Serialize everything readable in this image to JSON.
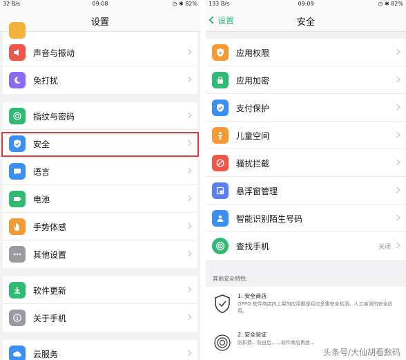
{
  "left": {
    "status": {
      "left": "32 B/s",
      "time": "09:08",
      "battery": "82%"
    },
    "title": "设置",
    "groups": [
      [
        {
          "label": "声音与振动",
          "icon": "speaker-icon",
          "color": "#f0564a"
        },
        {
          "label": "免打扰",
          "icon": "moon-icon",
          "color": "#8a6cf0"
        }
      ],
      [
        {
          "label": "指纹与密码",
          "icon": "fingerprint-icon",
          "color": "#2fbb73"
        },
        {
          "label": "安全",
          "icon": "shield-icon",
          "color": "#3b8ff3"
        },
        {
          "label": "语言",
          "icon": "language-icon",
          "color": "#3b8ff3"
        },
        {
          "label": "电池",
          "icon": "battery-icon",
          "color": "#2fbb73"
        },
        {
          "label": "手势体感",
          "icon": "hand-icon",
          "color": "#f59a32"
        },
        {
          "label": "其他设置",
          "icon": "more-icon",
          "color": "#9a9aa2"
        }
      ],
      [
        {
          "label": "软件更新",
          "icon": "update-icon",
          "color": "#2fbb73"
        },
        {
          "label": "关于手机",
          "icon": "info-icon",
          "color": "#9a9aa2"
        }
      ],
      [
        {
          "label": "云服务",
          "icon": "cloud-icon",
          "color": "#3b8ff3"
        }
      ]
    ]
  },
  "right": {
    "status": {
      "left": "133 B/s",
      "time": "09:09",
      "battery": "82%"
    },
    "back_label": "设置",
    "title": "安全",
    "items": [
      {
        "label": "应用权限",
        "icon": "shield-lock-icon",
        "color": "#f59a32"
      },
      {
        "label": "应用加密",
        "icon": "padlock-icon",
        "color": "#2fbb73"
      },
      {
        "label": "支付保护",
        "icon": "shield-check-icon",
        "color": "#3b8ff3"
      },
      {
        "label": "儿童空间",
        "icon": "child-icon",
        "color": "#f59a32"
      },
      {
        "label": "骚扰拦截",
        "icon": "block-icon",
        "color": "#f0564a"
      },
      {
        "label": "悬浮窗管理",
        "icon": "window-icon",
        "color": "#5b7ff0"
      },
      {
        "label": "智能识别陌生号码",
        "icon": "person-icon",
        "color": "#3b8ff3"
      },
      {
        "label": "查找手机",
        "icon": "radar-icon",
        "color": "#2fbb73",
        "value": "关闭"
      }
    ],
    "section_title": "其他安全特性:",
    "features": [
      {
        "title": "1. 安全商店",
        "desc": "OPPO 软件商店内上架的应用都是经过多重安全检测、人工亲测的安全应用。",
        "icon": "shield-check-outline-icon"
      },
      {
        "title": "2. 安全验证",
        "desc": "防扣费、防自启……软件商店再度…",
        "icon": "fingerprint-outline-icon"
      }
    ]
  },
  "watermark": "头条号/大仙胡看数码"
}
